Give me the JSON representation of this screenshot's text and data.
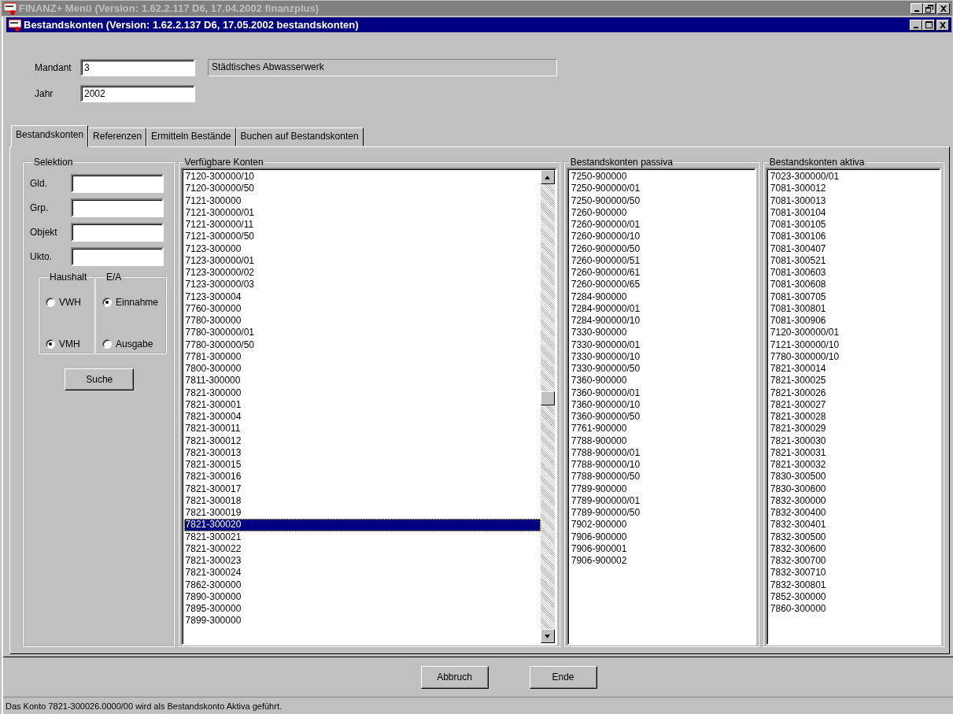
{
  "outer_window": {
    "title": "FINANZ+ Menü (Version: 1.62.2.117 D6, 17.04.2002 finanzplus)",
    "active": false,
    "controls": [
      {
        "kind": "minimize"
      },
      {
        "kind": "restore"
      },
      {
        "kind": "close"
      }
    ]
  },
  "window": {
    "title": "Bestandskonten (Version: 1.62.2.137 D6, 17.05.2002 bestandskonten)",
    "active": true,
    "controls": [
      {
        "kind": "minimize"
      },
      {
        "kind": "maximize"
      },
      {
        "kind": "close"
      }
    ]
  },
  "header": {
    "fields": [
      {
        "label": "Mandant",
        "value": "3"
      },
      {
        "label": "Jahr",
        "value": "2002"
      }
    ],
    "mandant_name": "Städtisches Abwasserwerk"
  },
  "tabs": [
    {
      "label": "Bestandskonten",
      "selected": true
    },
    {
      "label": "Referenzen",
      "selected": false
    },
    {
      "label": "Ermitteln Bestände",
      "selected": false
    },
    {
      "label": "Buchen auf Bestandskonten",
      "selected": false
    }
  ],
  "selection": {
    "title": "Selektion",
    "fields": [
      {
        "label": "Gld."
      },
      {
        "label": "Grp."
      },
      {
        "label": "Objekt"
      },
      {
        "label": "Ukto."
      }
    ],
    "radio_groups": [
      {
        "title": "Haushalt",
        "options": [
          {
            "label": "VWH",
            "selected": false
          },
          {
            "label": "VMH",
            "selected": true
          }
        ]
      },
      {
        "title": "E/A",
        "options": [
          {
            "label": "Einnahme",
            "selected": true
          },
          {
            "label": "Ausgabe",
            "selected": false
          }
        ]
      }
    ],
    "search_button": "Suche"
  },
  "lists": [
    {
      "title": "Verfügbare Konten",
      "scrollbar": true,
      "items": [
        {
          "text": "7120-300000/10",
          "selected": false
        },
        {
          "text": "7120-300000/50",
          "selected": false
        },
        {
          "text": "7121-300000",
          "selected": false
        },
        {
          "text": "7121-300000/01",
          "selected": false
        },
        {
          "text": "7121-300000/11",
          "selected": false
        },
        {
          "text": "7121-300000/50",
          "selected": false
        },
        {
          "text": "7123-300000",
          "selected": false
        },
        {
          "text": "7123-300000/01",
          "selected": false
        },
        {
          "text": "7123-300000/02",
          "selected": false
        },
        {
          "text": "7123-300000/03",
          "selected": false
        },
        {
          "text": "7123-300004",
          "selected": false
        },
        {
          "text": "7760-300000",
          "selected": false
        },
        {
          "text": "7780-300000",
          "selected": false
        },
        {
          "text": "7780-300000/01",
          "selected": false
        },
        {
          "text": "7780-300000/50",
          "selected": false
        },
        {
          "text": "7781-300000",
          "selected": false
        },
        {
          "text": "7800-300000",
          "selected": false
        },
        {
          "text": "7811-300000",
          "selected": false
        },
        {
          "text": "7821-300000",
          "selected": false
        },
        {
          "text": "7821-300001",
          "selected": false
        },
        {
          "text": "7821-300004",
          "selected": false
        },
        {
          "text": "7821-300011",
          "selected": false
        },
        {
          "text": "7821-300012",
          "selected": false
        },
        {
          "text": "7821-300013",
          "selected": false
        },
        {
          "text": "7821-300015",
          "selected": false
        },
        {
          "text": "7821-300016",
          "selected": false
        },
        {
          "text": "7821-300017",
          "selected": false
        },
        {
          "text": "7821-300018",
          "selected": false
        },
        {
          "text": "7821-300019",
          "selected": false
        },
        {
          "text": "7821-300020",
          "selected": true
        },
        {
          "text": "7821-300021",
          "selected": false
        },
        {
          "text": "7821-300022",
          "selected": false
        },
        {
          "text": "7821-300023",
          "selected": false
        },
        {
          "text": "7821-300024",
          "selected": false
        },
        {
          "text": "7862-300000",
          "selected": false
        },
        {
          "text": "7890-300000",
          "selected": false
        },
        {
          "text": "7895-300000",
          "selected": false
        },
        {
          "text": "7899-300000",
          "selected": false
        }
      ]
    },
    {
      "title": "Bestandskonten passiva",
      "scrollbar": false,
      "items": [
        {
          "text": "7250-900000",
          "selected": false
        },
        {
          "text": "7250-900000/01",
          "selected": false
        },
        {
          "text": "7250-900000/50",
          "selected": false
        },
        {
          "text": "7260-900000",
          "selected": false
        },
        {
          "text": "7260-900000/01",
          "selected": false
        },
        {
          "text": "7260-900000/10",
          "selected": false
        },
        {
          "text": "7260-900000/50",
          "selected": false
        },
        {
          "text": "7260-900000/51",
          "selected": false
        },
        {
          "text": "7260-900000/61",
          "selected": false
        },
        {
          "text": "7260-900000/65",
          "selected": false
        },
        {
          "text": "7284-900000",
          "selected": false
        },
        {
          "text": "7284-900000/01",
          "selected": false
        },
        {
          "text": "7284-900000/10",
          "selected": false
        },
        {
          "text": "7330-900000",
          "selected": false
        },
        {
          "text": "7330-900000/01",
          "selected": false
        },
        {
          "text": "7330-900000/10",
          "selected": false
        },
        {
          "text": "7330-900000/50",
          "selected": false
        },
        {
          "text": "7360-900000",
          "selected": false
        },
        {
          "text": "7360-900000/01",
          "selected": false
        },
        {
          "text": "7360-900000/10",
          "selected": false
        },
        {
          "text": "7360-900000/50",
          "selected": false
        },
        {
          "text": "7761-900000",
          "selected": false
        },
        {
          "text": "7788-900000",
          "selected": false
        },
        {
          "text": "7788-900000/01",
          "selected": false
        },
        {
          "text": "7788-900000/10",
          "selected": false
        },
        {
          "text": "7788-900000/50",
          "selected": false
        },
        {
          "text": "7789-900000",
          "selected": false
        },
        {
          "text": "7789-900000/01",
          "selected": false
        },
        {
          "text": "7789-900000/50",
          "selected": false
        },
        {
          "text": "7902-900000",
          "selected": false
        },
        {
          "text": "7906-900000",
          "selected": false
        },
        {
          "text": "7906-900001",
          "selected": false
        },
        {
          "text": "7906-900002",
          "selected": false
        }
      ]
    },
    {
      "title": "Bestandskonten aktiva",
      "scrollbar": false,
      "items": [
        {
          "text": "7023-300000/01",
          "selected": false
        },
        {
          "text": "7081-300012",
          "selected": false
        },
        {
          "text": "7081-300013",
          "selected": false
        },
        {
          "text": "7081-300104",
          "selected": false
        },
        {
          "text": "7081-300105",
          "selected": false
        },
        {
          "text": "7081-300106",
          "selected": false
        },
        {
          "text": "7081-300407",
          "selected": false
        },
        {
          "text": "7081-300521",
          "selected": false
        },
        {
          "text": "7081-300603",
          "selected": false
        },
        {
          "text": "7081-300608",
          "selected": false
        },
        {
          "text": "7081-300705",
          "selected": false
        },
        {
          "text": "7081-300801",
          "selected": false
        },
        {
          "text": "7081-300906",
          "selected": false
        },
        {
          "text": "7120-300000/01",
          "selected": false
        },
        {
          "text": "7121-300000/10",
          "selected": false
        },
        {
          "text": "7780-300000/10",
          "selected": false
        },
        {
          "text": "7821-300014",
          "selected": false
        },
        {
          "text": "7821-300025",
          "selected": false
        },
        {
          "text": "7821-300026",
          "selected": false
        },
        {
          "text": "7821-300027",
          "selected": false
        },
        {
          "text": "7821-300028",
          "selected": false
        },
        {
          "text": "7821-300029",
          "selected": false
        },
        {
          "text": "7821-300030",
          "selected": false
        },
        {
          "text": "7821-300031",
          "selected": false
        },
        {
          "text": "7821-300032",
          "selected": false
        },
        {
          "text": "7830-300500",
          "selected": false
        },
        {
          "text": "7830-300600",
          "selected": false
        },
        {
          "text": "7832-300000",
          "selected": false
        },
        {
          "text": "7832-300400",
          "selected": false
        },
        {
          "text": "7832-300401",
          "selected": false
        },
        {
          "text": "7832-300500",
          "selected": false
        },
        {
          "text": "7832-300600",
          "selected": false
        },
        {
          "text": "7832-300700",
          "selected": false
        },
        {
          "text": "7832-300710",
          "selected": false
        },
        {
          "text": "7832-300801",
          "selected": false
        },
        {
          "text": "7852-300000",
          "selected": false
        },
        {
          "text": "7860-300000",
          "selected": false
        }
      ]
    }
  ],
  "buttons": [
    "Abbruch",
    "Ende"
  ],
  "status_bar": "Das Konto 7821-300026.0000/00 wird als Bestandskonto Aktiva geführt."
}
